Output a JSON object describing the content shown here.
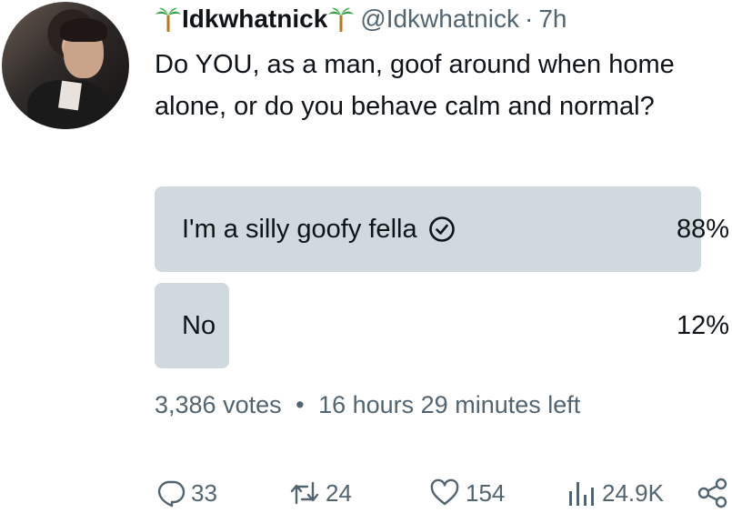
{
  "tweet": {
    "display_name": "Idkwhatnick",
    "handle": "@Idkwhatnick",
    "separator": "·",
    "time": "7h",
    "text": "Do YOU, as a man, goof around when home alone, or do you behave calm and normal?"
  },
  "poll": {
    "options": [
      {
        "label": "I'm a silly goofy fella",
        "percent": "88%",
        "fraction": 0.88,
        "selected": true
      },
      {
        "label": "No",
        "percent": "12%",
        "fraction": 0.12,
        "selected": false
      }
    ],
    "votes": "3,386 votes",
    "meta_separator": "•",
    "time_left": "16 hours 29 minutes left"
  },
  "actions": {
    "replies": "33",
    "retweets": "24",
    "likes": "154",
    "views": "24.9K"
  },
  "colors": {
    "bar": "#cfd9de",
    "secondary_text": "#536471",
    "primary_text": "#0f1419"
  },
  "icons": [
    "palm-tree-icon",
    "check-circle-icon",
    "reply-icon",
    "retweet-icon",
    "like-icon",
    "views-icon",
    "share-icon"
  ]
}
